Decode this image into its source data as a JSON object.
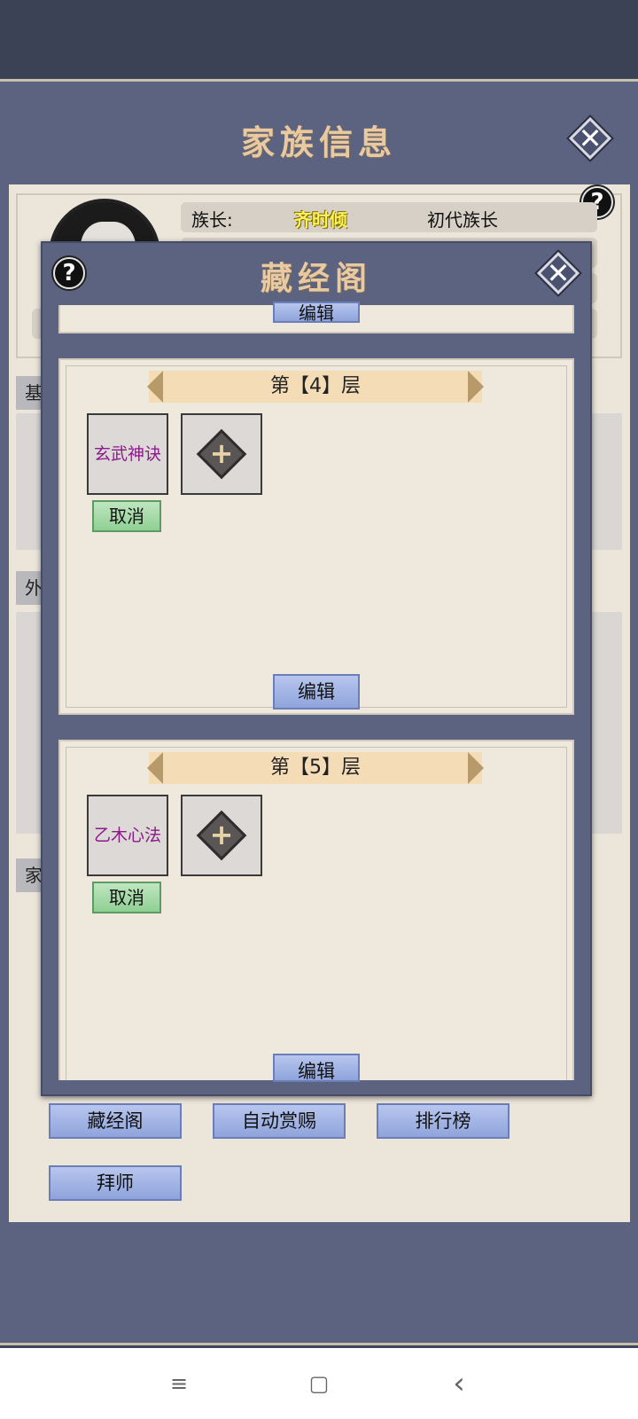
{
  "window": {
    "title": "家族信息"
  },
  "info": {
    "leader_label": "族长:",
    "leader_name": "齐时倾",
    "leader_rank": "初代族长"
  },
  "section_tabs": [
    "基",
    "外",
    "家"
  ],
  "bottom_buttons": {
    "library": "藏经阁",
    "auto_reward": "自动赏赐",
    "ranking": "排行榜",
    "apprentice": "拜师"
  },
  "modal": {
    "title": "藏经阁",
    "edit_label": "编辑",
    "floors": [
      {
        "banner": "第【4】层",
        "technique": "玄武神诀",
        "cancel_label": "取消"
      },
      {
        "banner": "第【5】层",
        "technique": "乙木心法",
        "cancel_label": "取消"
      }
    ]
  },
  "nav": {
    "menu": "≡",
    "home": "▢",
    "back": "‹"
  },
  "colors": {
    "frame": "#5b6380",
    "panel": "#ece5da",
    "title_gold": "#e8c9a2",
    "technique_purple": "#8a1a8a"
  }
}
